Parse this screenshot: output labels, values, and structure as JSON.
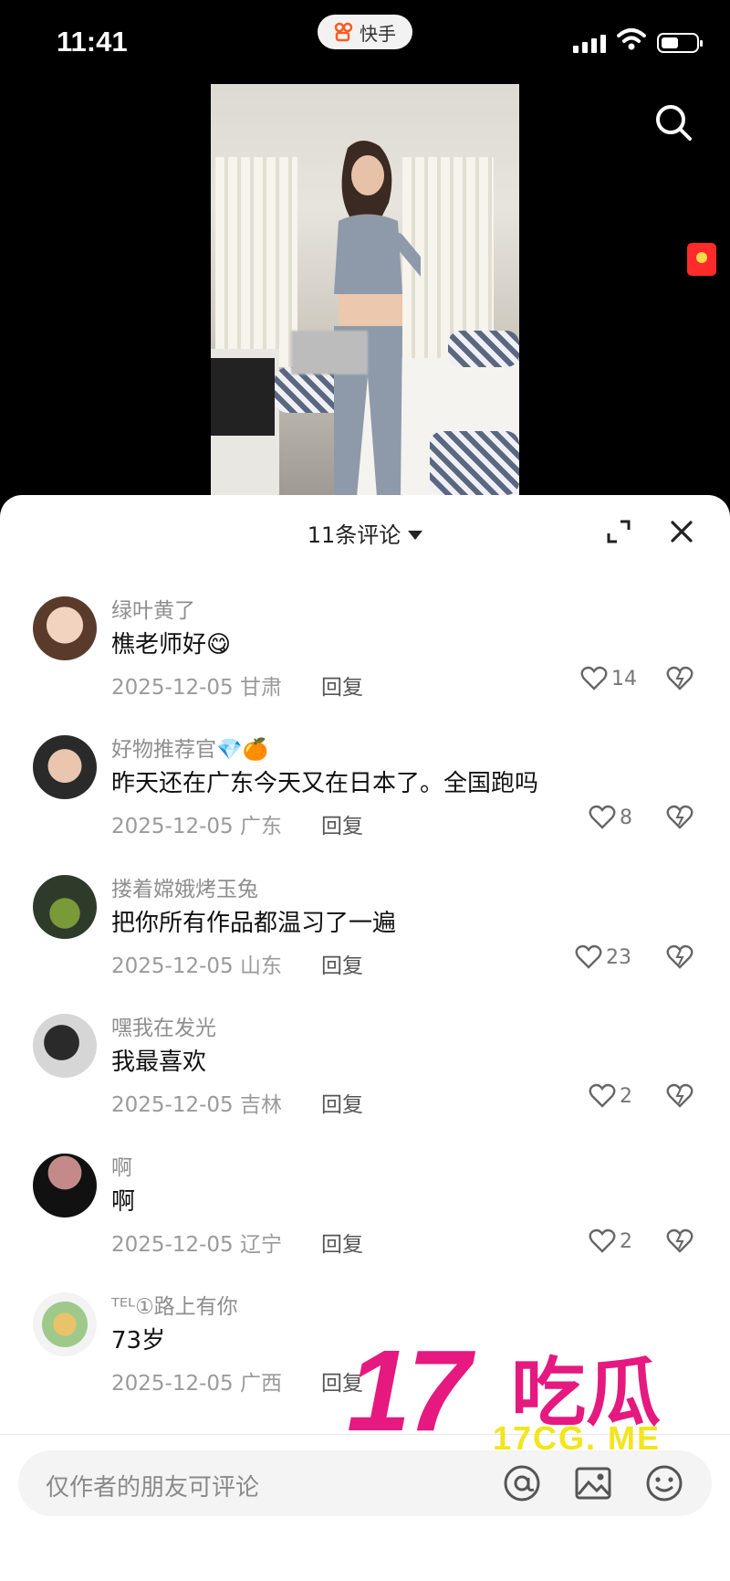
{
  "status_bar": {
    "time": "11:41",
    "app_name": "快手"
  },
  "video": {
    "description_icon": "video-frame"
  },
  "comments_panel": {
    "title": "11条评论",
    "comments": [
      {
        "username": "绿叶黄了",
        "text": "樵老师好😋",
        "date": "2025-12-05",
        "region": "甘肃",
        "reply_label": "回复",
        "likes": "14"
      },
      {
        "username": "好物推荐官💎🍊",
        "text": "昨天还在广东今天又在日本了。全国跑吗",
        "date": "2025-12-05",
        "region": "广东",
        "reply_label": "回复",
        "likes": "8"
      },
      {
        "username": "搂着嫦娥烤玉兔",
        "text": "把你所有作品都温习了一遍",
        "date": "2025-12-05",
        "region": "山东",
        "reply_label": "回复",
        "likes": "23"
      },
      {
        "username": "嘿我在发光",
        "text": "我最喜欢",
        "date": "2025-12-05",
        "region": "吉林",
        "reply_label": "回复",
        "likes": "2"
      },
      {
        "username": "啊",
        "text": "啊",
        "date": "2025-12-05",
        "region": "辽宁",
        "reply_label": "回复",
        "likes": "2"
      },
      {
        "username": "ᵀᴱᴸ①路上有你",
        "text": "73岁",
        "date": "2025-12-05",
        "region": "广西",
        "reply_label": "回复",
        "likes": ""
      }
    ],
    "input_placeholder": "仅作者的朋友可评论"
  },
  "watermark": {
    "number": "17",
    "text": "吃瓜",
    "url": "17CG. ME"
  },
  "colors": {
    "accent": "#e5197f",
    "watermark_url": "#f2e51c"
  }
}
